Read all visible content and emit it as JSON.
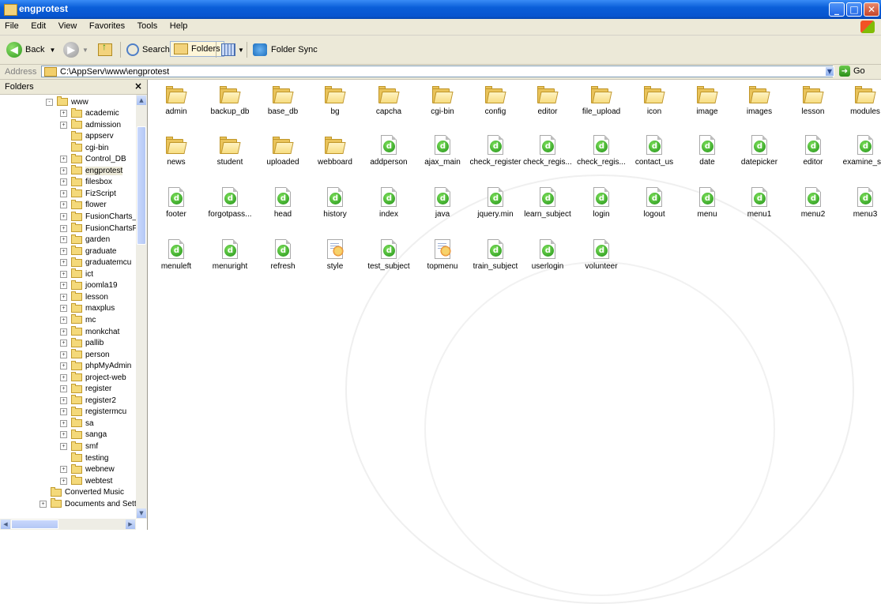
{
  "window": {
    "title": "engprotest"
  },
  "menu": [
    "File",
    "Edit",
    "View",
    "Favorites",
    "Tools",
    "Help"
  ],
  "toolbar": {
    "back": "Back",
    "search": "Search",
    "folders": "Folders",
    "folder_sync": "Folder Sync"
  },
  "address": {
    "label": "Address",
    "value": "C:\\AppServ\\www\\engprotest",
    "go": "Go"
  },
  "folders_pane": {
    "title": "Folders",
    "tree": [
      {
        "label": "www",
        "level": 1,
        "toggle": "-"
      },
      {
        "label": "academic",
        "level": 2,
        "toggle": "+"
      },
      {
        "label": "admission",
        "level": 2,
        "toggle": "+"
      },
      {
        "label": "appserv",
        "level": 2,
        "toggle": ""
      },
      {
        "label": "cgi-bin",
        "level": 2,
        "toggle": ""
      },
      {
        "label": "Control_DB",
        "level": 2,
        "toggle": "+"
      },
      {
        "label": "engprotest",
        "level": 2,
        "toggle": "+",
        "selected": true
      },
      {
        "label": "filesbox",
        "level": 2,
        "toggle": "+"
      },
      {
        "label": "FizScript",
        "level": 2,
        "toggle": "+"
      },
      {
        "label": "flower",
        "level": 2,
        "toggle": "+"
      },
      {
        "label": "FusionCharts_I",
        "level": 2,
        "toggle": "+"
      },
      {
        "label": "FusionChartsFr",
        "level": 2,
        "toggle": "+"
      },
      {
        "label": "garden",
        "level": 2,
        "toggle": "+"
      },
      {
        "label": "graduate",
        "level": 2,
        "toggle": "+"
      },
      {
        "label": "graduatemcu",
        "level": 2,
        "toggle": "+"
      },
      {
        "label": "ict",
        "level": 2,
        "toggle": "+"
      },
      {
        "label": "joomla19",
        "level": 2,
        "toggle": "+"
      },
      {
        "label": "lesson",
        "level": 2,
        "toggle": "+"
      },
      {
        "label": "maxplus",
        "level": 2,
        "toggle": "+"
      },
      {
        "label": "mc",
        "level": 2,
        "toggle": "+"
      },
      {
        "label": "monkchat",
        "level": 2,
        "toggle": "+"
      },
      {
        "label": "pallib",
        "level": 2,
        "toggle": "+"
      },
      {
        "label": "person",
        "level": 2,
        "toggle": "+"
      },
      {
        "label": "phpMyAdmin",
        "level": 2,
        "toggle": "+"
      },
      {
        "label": "project-web",
        "level": 2,
        "toggle": "+"
      },
      {
        "label": "register",
        "level": 2,
        "toggle": "+"
      },
      {
        "label": "register2",
        "level": 2,
        "toggle": "+"
      },
      {
        "label": "registermcu",
        "level": 2,
        "toggle": "+"
      },
      {
        "label": "sa",
        "level": 2,
        "toggle": "+"
      },
      {
        "label": "sanga",
        "level": 2,
        "toggle": "+"
      },
      {
        "label": "smf",
        "level": 2,
        "toggle": "+"
      },
      {
        "label": "testing",
        "level": 2,
        "toggle": ""
      },
      {
        "label": "webnew",
        "level": 2,
        "toggle": "+"
      },
      {
        "label": "webtest",
        "level": 2,
        "toggle": "+"
      },
      {
        "label": "Converted Music",
        "level": 0,
        "toggle": ""
      },
      {
        "label": "Documents and Setting",
        "level": 0,
        "toggle": "+"
      }
    ]
  },
  "files": [
    {
      "name": "admin",
      "type": "folder"
    },
    {
      "name": "backup_db",
      "type": "folder"
    },
    {
      "name": "base_db",
      "type": "folder"
    },
    {
      "name": "bg",
      "type": "folder"
    },
    {
      "name": "capcha",
      "type": "folder"
    },
    {
      "name": "cgi-bin",
      "type": "folder"
    },
    {
      "name": "config",
      "type": "folder"
    },
    {
      "name": "editor",
      "type": "folder"
    },
    {
      "name": "file_upload",
      "type": "folder"
    },
    {
      "name": "icon",
      "type": "folder"
    },
    {
      "name": "image",
      "type": "folder"
    },
    {
      "name": "images",
      "type": "folder"
    },
    {
      "name": "lesson",
      "type": "folder"
    },
    {
      "name": "modules",
      "type": "folder"
    },
    {
      "name": "news",
      "type": "folder"
    },
    {
      "name": "student",
      "type": "folder"
    },
    {
      "name": "uploaded",
      "type": "folder"
    },
    {
      "name": "webboard",
      "type": "folder"
    },
    {
      "name": "addperson",
      "type": "php"
    },
    {
      "name": "ajax_main",
      "type": "php"
    },
    {
      "name": "check_register",
      "type": "php"
    },
    {
      "name": "check_regis...",
      "type": "php"
    },
    {
      "name": "check_regis...",
      "type": "php"
    },
    {
      "name": "contact_us",
      "type": "php"
    },
    {
      "name": "date",
      "type": "php"
    },
    {
      "name": "datepicker",
      "type": "php"
    },
    {
      "name": "editor",
      "type": "php"
    },
    {
      "name": "examine_s...",
      "type": "php"
    },
    {
      "name": "footer",
      "type": "php"
    },
    {
      "name": "forgotpass...",
      "type": "php"
    },
    {
      "name": "head",
      "type": "php"
    },
    {
      "name": "history",
      "type": "php"
    },
    {
      "name": "index",
      "type": "php"
    },
    {
      "name": "java",
      "type": "php"
    },
    {
      "name": "jquery.min",
      "type": "php"
    },
    {
      "name": "learn_subject",
      "type": "php"
    },
    {
      "name": "login",
      "type": "php"
    },
    {
      "name": "logout",
      "type": "php"
    },
    {
      "name": "menu",
      "type": "php"
    },
    {
      "name": "menu1",
      "type": "php"
    },
    {
      "name": "menu2",
      "type": "php"
    },
    {
      "name": "menu3",
      "type": "php"
    },
    {
      "name": "menuleft",
      "type": "php"
    },
    {
      "name": "menuright",
      "type": "php"
    },
    {
      "name": "refresh",
      "type": "php"
    },
    {
      "name": "style",
      "type": "css"
    },
    {
      "name": "test_subject",
      "type": "php"
    },
    {
      "name": "topmenu",
      "type": "css"
    },
    {
      "name": "train_subject",
      "type": "php"
    },
    {
      "name": "userlogin",
      "type": "php"
    },
    {
      "name": "volunteer",
      "type": "php"
    }
  ]
}
